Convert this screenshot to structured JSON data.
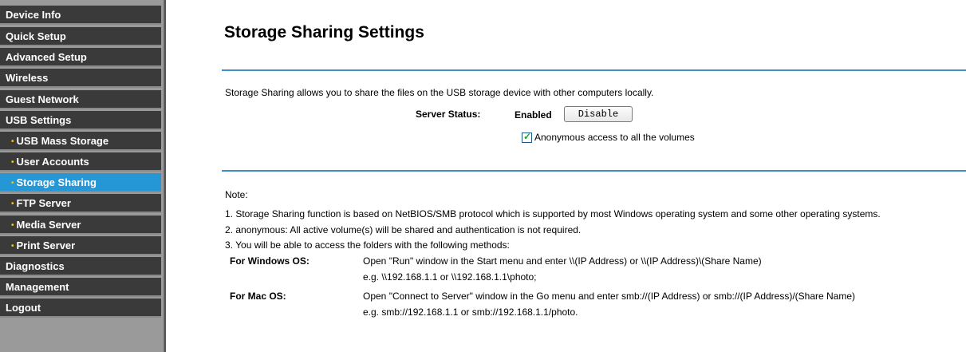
{
  "sidebar": {
    "items": [
      {
        "label": "Device Info",
        "sub": false
      },
      {
        "label": "Quick Setup",
        "sub": false
      },
      {
        "label": "Advanced Setup",
        "sub": false
      },
      {
        "label": "Wireless",
        "sub": false
      },
      {
        "label": "Guest Network",
        "sub": false
      },
      {
        "label": "USB Settings",
        "sub": false
      },
      {
        "label": "USB Mass Storage",
        "sub": true
      },
      {
        "label": "User Accounts",
        "sub": true
      },
      {
        "label": "Storage Sharing",
        "sub": true,
        "active": true
      },
      {
        "label": "FTP Server",
        "sub": true
      },
      {
        "label": "Media Server",
        "sub": true
      },
      {
        "label": "Print Server",
        "sub": true
      },
      {
        "label": "Diagnostics",
        "sub": false
      },
      {
        "label": "Management",
        "sub": false
      },
      {
        "label": "Logout",
        "sub": false
      }
    ],
    "bullet": "•"
  },
  "main": {
    "title": "Storage Sharing Settings",
    "description": "Storage Sharing allows you to share the files on the USB storage device with other computers locally.",
    "server_status_label": "Server Status:",
    "server_status_value": "Enabled",
    "disable_button": "Disable",
    "anonymous_checkbox": {
      "checked": true,
      "label": "Anonymous access to all the volumes"
    },
    "note": {
      "heading": "Note:",
      "lines": [
        "1. Storage Sharing function is based on NetBIOS/SMB protocol which is supported by most Windows operating system and some other operating systems.",
        "2. anonymous: All active volume(s) will be shared and authentication is not required.",
        "3. You will be able to access the folders with the following methods:"
      ],
      "windows_label": "For Windows OS:",
      "windows_line1": "Open \"Run\" window in the Start menu and enter \\\\(IP Address) or \\\\(IP Address)\\(Share Name)",
      "windows_line2": "e.g. \\\\192.168.1.1 or \\\\192.168.1.1\\photo;",
      "mac_label": "For Mac OS:",
      "mac_line1": "Open \"Connect to Server\" window in the Go menu and enter smb://(IP Address) or smb://(IP Address)/(Share Name)",
      "mac_line2": "e.g. smb://192.168.1.1 or smb://192.168.1.1/photo."
    }
  },
  "colors": {
    "active": "#2597d6",
    "nav": "#3a3a3a",
    "rule": "#3d8fc4",
    "bullet": "#f5c500"
  }
}
